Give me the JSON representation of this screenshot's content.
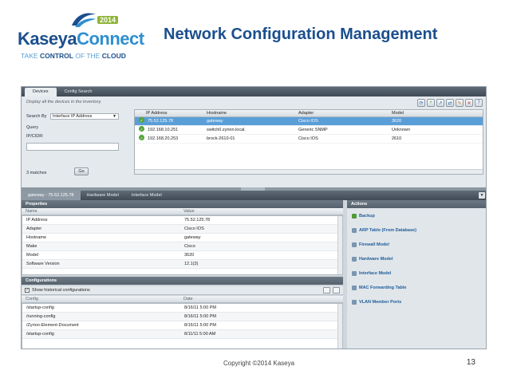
{
  "header": {
    "brand_kaseya": "Kaseya",
    "brand_connect": "Connect",
    "brand_year": "2014",
    "tagline_pre": "TAKE ",
    "tagline_control": "CONTROL",
    "tagline_mid": " OF THE ",
    "tagline_cloud": "CLOUD",
    "title": "Network Configuration Management"
  },
  "app": {
    "tabs": [
      {
        "label": "Devices",
        "active": true
      },
      {
        "label": "Config Search",
        "active": false
      }
    ],
    "search": {
      "hint": "Display all the devices in the inventory.",
      "search_by_label": "Search By",
      "search_by_value": "Interface IP Address",
      "query_label": "Query",
      "ip_label": "IP/CIDR:",
      "ip_value": "",
      "matches": "3 matches",
      "go_label": "Go"
    },
    "toolbar_icons": [
      "refresh-icon",
      "add-icon",
      "export-icon",
      "compare-icon",
      "edit-icon",
      "delete-icon",
      "help-icon"
    ],
    "devices": {
      "columns": [
        "IP Address",
        "Hostname",
        "Adapter",
        "Model"
      ],
      "rows": [
        {
          "ip": "75.52.125.78",
          "hostname": "gateway",
          "adapter": "Cisco IOS",
          "model": "3620",
          "selected": true
        },
        {
          "ip": "192.168.10.251",
          "hostname": "switch0.zyrion.local.",
          "adapter": "Generic SNMP",
          "model": "Unknown",
          "selected": false
        },
        {
          "ip": "192.168.20.253",
          "hostname": "brock-2610-01",
          "adapter": "Cisco IOS",
          "model": "2610",
          "selected": false
        }
      ]
    },
    "subtabs": [
      {
        "label": "gateway - 75.52.125.78",
        "active": true
      },
      {
        "label": "Hardware Model",
        "active": false
      },
      {
        "label": "Interface Model",
        "active": false
      }
    ],
    "properties": {
      "title": "Properties",
      "columns": [
        "Name",
        "Value"
      ],
      "rows": [
        {
          "name": "IP Address",
          "value": "75.52.125.78"
        },
        {
          "name": "Adapter",
          "value": "Cisco IOS"
        },
        {
          "name": "Hostname",
          "value": "gateway"
        },
        {
          "name": "Make",
          "value": "Cisco"
        },
        {
          "name": "Model",
          "value": "3620"
        },
        {
          "name": "Software Version",
          "value": "12.1(3)"
        }
      ]
    },
    "configurations": {
      "title": "Configurations",
      "show_historical": "Show historical configurations",
      "columns": [
        "Config",
        "Date"
      ],
      "rows": [
        {
          "config": "/startup-config",
          "date": "8/16/11 5:00 PM"
        },
        {
          "config": "/running-config",
          "date": "8/16/11 5:00 PM"
        },
        {
          "config": "/Zyrion-Element-Document",
          "date": "8/16/11 5:00 PM"
        },
        {
          "config": "/startup-config",
          "date": "8/11/11 5:00 AM"
        }
      ]
    },
    "actions": {
      "title": "Actions",
      "items": [
        "Backup",
        "ARP Table (From Database)",
        "Firewall Model",
        "Hardware Model",
        "Interface Model",
        "MAC Forwarding Table",
        "VLAN Member Ports"
      ]
    }
  },
  "footer": {
    "copyright": "Copyright ©2014 Kaseya",
    "page_number": "13"
  }
}
